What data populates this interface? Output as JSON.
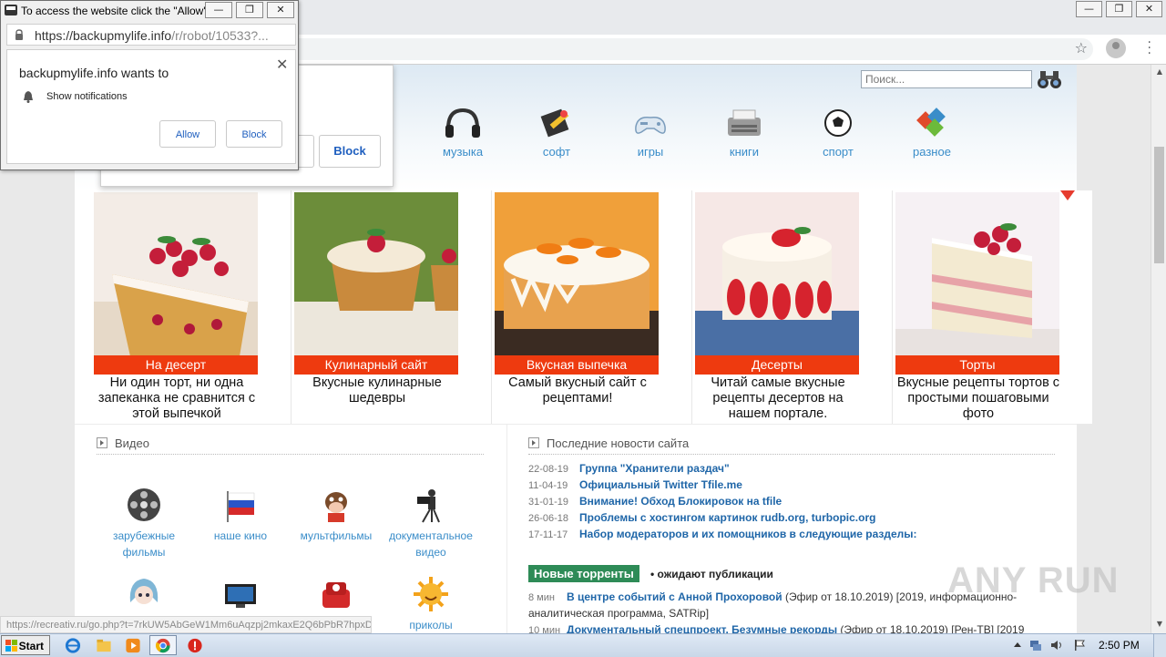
{
  "popup": {
    "window_title": "To access the website click the \"Allow\"...",
    "url_host": "https://backupmylife.info",
    "url_path": "/r/robot/10533?...",
    "heading": "backupmylife.info wants to",
    "permission": "Show notifications",
    "allow_label": "Allow",
    "block_label": "Block",
    "close_glyph": "✕",
    "win_min": "—",
    "win_max": "❐",
    "win_close": "✕"
  },
  "ghost_block_label": "Block",
  "search": {
    "placeholder": "Поиск..."
  },
  "categories": [
    {
      "label": "музыка",
      "icon": "headphones-icon"
    },
    {
      "label": "софт",
      "icon": "software-icon"
    },
    {
      "label": "игры",
      "icon": "gamepad-icon"
    },
    {
      "label": "книги",
      "icon": "typewriter-icon"
    },
    {
      "label": "спорт",
      "icon": "soccer-ball-icon"
    },
    {
      "label": "разное",
      "icon": "misc-icon"
    }
  ],
  "cards": [
    {
      "ribbon": "На десерт",
      "desc": "Ни один торт, ни одна запеканка не сравнится с этой выпечкой"
    },
    {
      "ribbon": "Кулинарный сайт",
      "desc": "Вкусные кулинарные шедевры"
    },
    {
      "ribbon": "Вкусная выпечка",
      "desc": "Самый вкусный сайт с рецептами!"
    },
    {
      "ribbon": "Десерты",
      "desc": "Читай самые вкусные рецепты десертов на нашем портале."
    },
    {
      "ribbon": "Торты",
      "desc": "Вкусные рецепты тортов с простыми пошаговыми фото"
    }
  ],
  "video": {
    "title": "Видео",
    "items": [
      {
        "label": "зарубежные фильмы"
      },
      {
        "label": "наше кино"
      },
      {
        "label": "мультфильмы"
      },
      {
        "label": "документальное видео"
      },
      {
        "label": ""
      },
      {
        "label": ""
      },
      {
        "label": ""
      },
      {
        "label": "приколы"
      }
    ]
  },
  "news": {
    "title": "Последние новости сайта",
    "rows": [
      {
        "date": "22-08-19",
        "text": "Группа \"Хранители раздач\""
      },
      {
        "date": "11-04-19",
        "text": "Официальный Twitter Tfile.me"
      },
      {
        "date": "31-01-19",
        "text": "Внимание! Обход Блокировок на tfile"
      },
      {
        "date": "26-06-18",
        "text": "Проблемы с хостингом картинок rudb.org, turbopic.org"
      },
      {
        "date": "17-11-17",
        "text": "Набор модераторов и их помощников в следующие разделы:"
      }
    ]
  },
  "torrents": {
    "badge": "Новые торренты",
    "tail": "• ожидают публикации",
    "rows": [
      {
        "time": "8 мин",
        "title": "В центре событий с Анной Прохоровой",
        "meta": " (Эфир от 18.10.2019) [2019, информационно-аналитическая программа, SATRip]"
      },
      {
        "time": "10 мин",
        "title": "Документальный спецпроект. Безумные рекорды",
        "meta": " (Эфир от 18.10.2019) [Рен-ТВ] [2019"
      }
    ]
  },
  "status_url": "https://recreativ.ru/go.php?t=7rkUW5AbGeW1Mm6uAqzpj2mkaxE2Q6bPbR7hpxDf",
  "watermark": "ANY RUN",
  "taskbar": {
    "start_label": "Start",
    "clock": "2:50 PM"
  },
  "colors": {
    "ribbon": "#ee3a0f",
    "link": "#1f66a8",
    "category": "#3a8dc9",
    "torrent_badge": "#2e8b57"
  }
}
